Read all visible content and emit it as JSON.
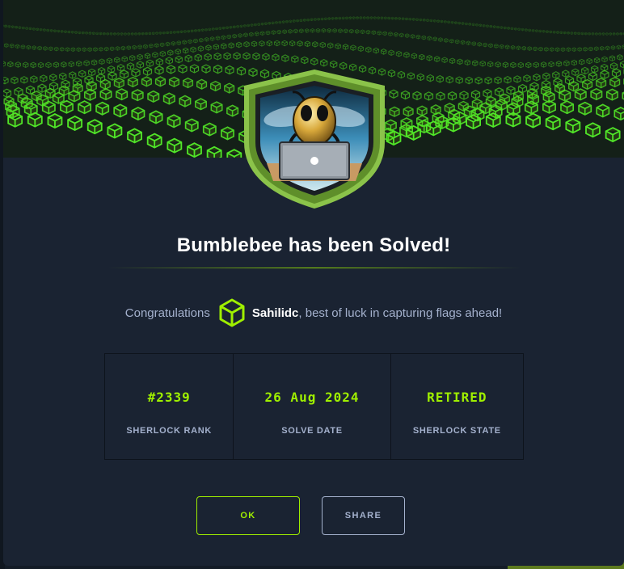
{
  "dialog": {
    "title": "Bumblebee has been Solved!",
    "congrats_prefix": "Congratulations",
    "username": "Sahilidc",
    "congrats_suffix": ", best of luck in capturing flags ahead!"
  },
  "stats": [
    {
      "value": "#2339",
      "label": "SHERLOCK RANK"
    },
    {
      "value": "26 Aug 2024",
      "label": "SOLVE DATE"
    },
    {
      "value": "RETIRED",
      "label": "SHERLOCK STATE"
    }
  ],
  "buttons": {
    "ok": "OK",
    "share": "SHARE"
  },
  "colors": {
    "accent": "#9fef00",
    "modal_bg": "#1a2332",
    "text_muted": "#a4b1cd",
    "badge_shield": "#8bc34a"
  },
  "icons": {
    "badge": "bumblebee-shield-badge",
    "user": "hexagon-cube-icon",
    "banner": "green-cube-grid-wave"
  }
}
